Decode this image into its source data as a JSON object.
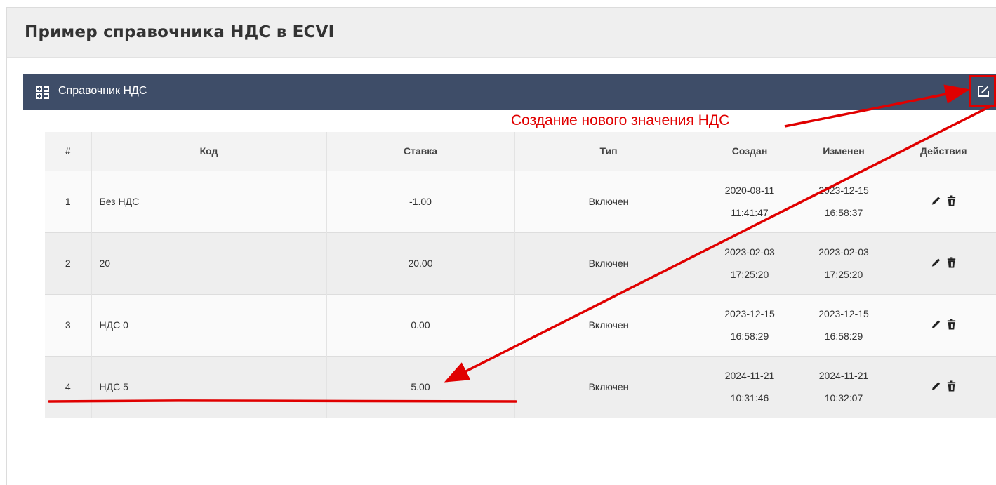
{
  "page": {
    "title": "Пример справочника НДС в ECVI"
  },
  "panel": {
    "title": "Справочник НДС",
    "icon": "grid-add-icon",
    "edit_icon": "edit-square-icon",
    "bar_color": "#3e4d68"
  },
  "annotation": {
    "text": "Создание нового значения НДС",
    "color": "#e00000"
  },
  "table": {
    "headers": {
      "num": "#",
      "code": "Код",
      "rate": "Ставка",
      "type": "Тип",
      "created": "Создан",
      "modified": "Изменен",
      "actions": "Действия"
    },
    "rows": [
      {
        "num": "1",
        "code": "Без НДС",
        "rate": "-1.00",
        "type": "Включен",
        "created_date": "2020-08-11",
        "created_time": "11:41:47",
        "modified_date": "2023-12-15",
        "modified_time": "16:58:37"
      },
      {
        "num": "2",
        "code": "20",
        "rate": "20.00",
        "type": "Включен",
        "created_date": "2023-02-03",
        "created_time": "17:25:20",
        "modified_date": "2023-02-03",
        "modified_time": "17:25:20"
      },
      {
        "num": "3",
        "code": "НДС 0",
        "rate": "0.00",
        "type": "Включен",
        "created_date": "2023-12-15",
        "created_time": "16:58:29",
        "modified_date": "2023-12-15",
        "modified_time": "16:58:29"
      },
      {
        "num": "4",
        "code": "НДС 5",
        "rate": "5.00",
        "type": "Включен",
        "created_date": "2024-11-21",
        "created_time": "10:31:46",
        "modified_date": "2024-11-21",
        "modified_time": "10:32:07"
      }
    ],
    "row_actions": [
      "pencil-icon",
      "trash-icon"
    ]
  }
}
